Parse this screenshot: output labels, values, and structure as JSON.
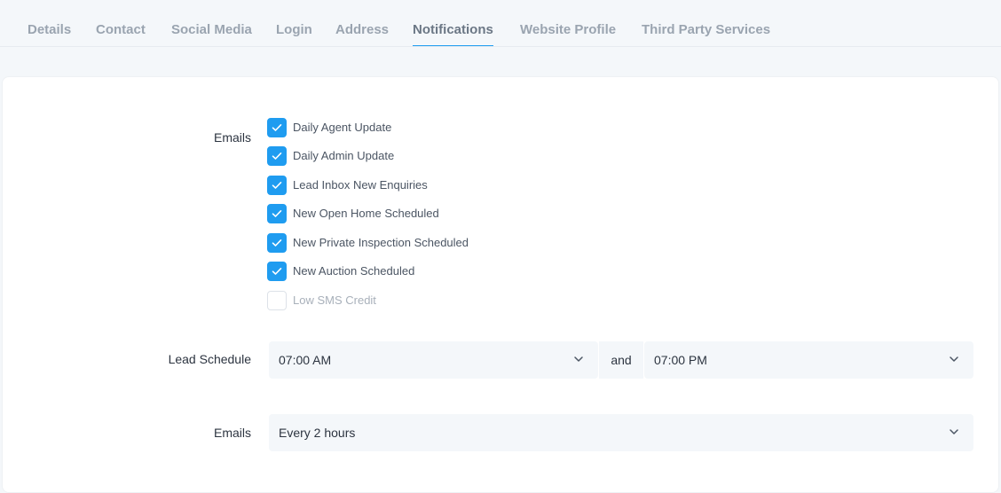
{
  "tabs": [
    {
      "label": "Details"
    },
    {
      "label": "Contact"
    },
    {
      "label": "Social Media"
    },
    {
      "label": "Login"
    },
    {
      "label": "Address"
    },
    {
      "label": "Notifications",
      "active": true
    },
    {
      "label": "Website Profile"
    },
    {
      "label": "Third Party Services"
    }
  ],
  "emails_section": {
    "label": "Emails",
    "options": [
      {
        "label": "Daily Agent Update",
        "checked": true
      },
      {
        "label": "Daily Admin Update",
        "checked": true
      },
      {
        "label": "Lead Inbox New Enquiries",
        "checked": true
      },
      {
        "label": "New Open Home Scheduled",
        "checked": true
      },
      {
        "label": "New Private Inspection Scheduled",
        "checked": true
      },
      {
        "label": "New Auction Scheduled",
        "checked": true
      },
      {
        "label": "Low SMS Credit",
        "checked": false,
        "disabled": true
      }
    ]
  },
  "lead_schedule": {
    "label": "Lead Schedule",
    "start_time": "07:00 AM",
    "connector": "and",
    "end_time": "07:00 PM"
  },
  "emails_frequency": {
    "label": "Emails",
    "value": "Every 2 hours"
  },
  "colors": {
    "accent": "#1f9cf0",
    "background": "#f4f7fa",
    "card": "#ffffff"
  }
}
